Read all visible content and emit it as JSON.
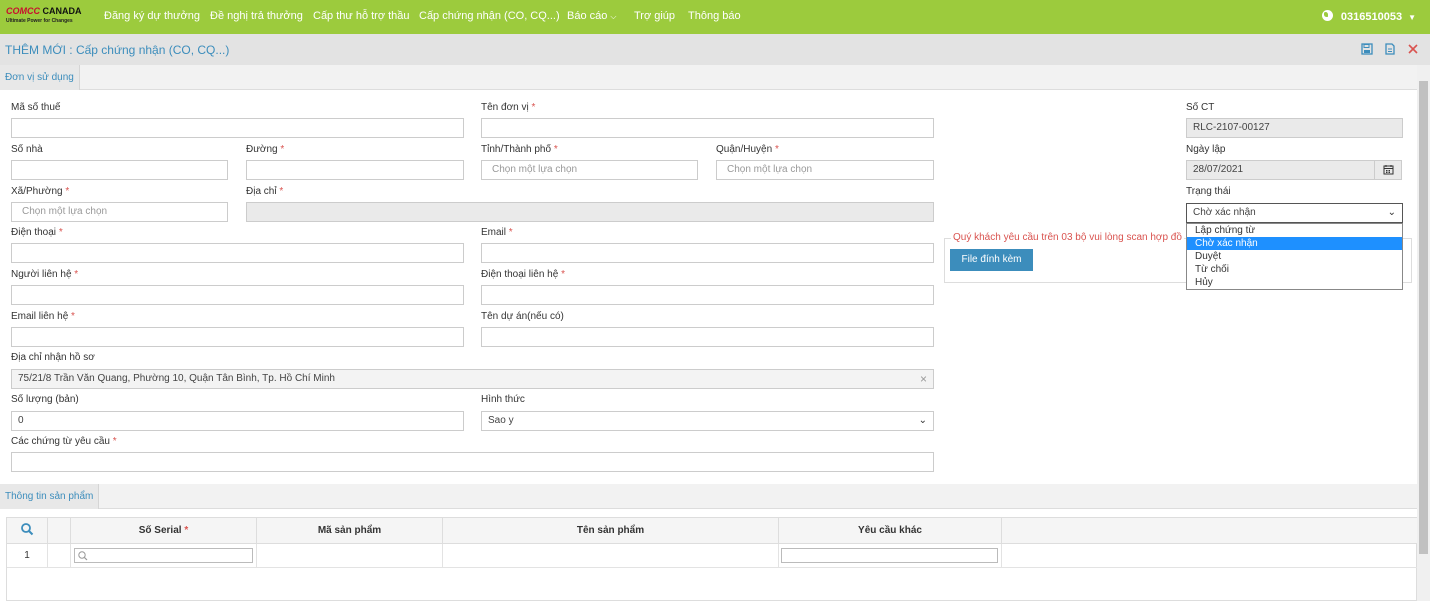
{
  "nav": {
    "logo_line1a": "COMCC",
    "logo_line1b": "CANADA",
    "logo_line2": "Ultimate Power for Changes",
    "items": [
      {
        "label": "Đăng ký dự thưởng"
      },
      {
        "label": "Đề nghị trả thưởng"
      },
      {
        "label": "Cấp thư hỗ trợ thầu"
      },
      {
        "label": "Cấp chứng nhận (CO, CQ...)"
      },
      {
        "label": "Báo cáo"
      },
      {
        "label": "Trợ giúp"
      },
      {
        "label": "Thông báo"
      }
    ],
    "account": "0316510053"
  },
  "colors": {
    "nav_bg": "#9ccb3d",
    "accent": "#3c8dbc",
    "required": "#d9534f",
    "selected": "#1e90ff"
  },
  "title": "THÊM MỚI : Cấp chứng nhận (CO, CQ...)",
  "toolbar_icons": [
    "save-icon",
    "document-icon",
    "close-icon"
  ],
  "section1": {
    "tab": "Đơn vị sử dụng"
  },
  "form": {
    "ma_so_thue": {
      "label": "Mã số thuế",
      "value": ""
    },
    "ten_don_vi": {
      "label": "Tên đơn vị",
      "value": ""
    },
    "so_ct": {
      "label": "Số CT",
      "value": "RLC-2107-00127"
    },
    "so_nha": {
      "label": "Số nhà",
      "value": ""
    },
    "duong": {
      "label": "Đường",
      "value": ""
    },
    "tinh": {
      "label": "Tỉnh/Thành phố",
      "placeholder": "Chọn một lựa chọn"
    },
    "quan": {
      "label": "Quận/Huyện",
      "placeholder": "Chọn một lựa chọn"
    },
    "ngay_lap": {
      "label": "Ngày lập",
      "value": "28/07/2021"
    },
    "xa": {
      "label": "Xã/Phường",
      "placeholder": "Chọn một lựa chọn"
    },
    "dia_chi": {
      "label": "Địa chỉ",
      "value": ""
    },
    "trang_thai": {
      "label": "Trạng thái",
      "value": "Chờ xác nhận",
      "options": [
        "Lập chứng từ",
        "Chờ xác nhận",
        "Duyệt",
        "Từ chối",
        "Hủy"
      ]
    },
    "dien_thoai": {
      "label": "Điện thoại",
      "value": ""
    },
    "email": {
      "label": "Email",
      "value": ""
    },
    "nguoi_lien_he": {
      "label": "Người liên hệ",
      "value": ""
    },
    "dt_lien_he": {
      "label": "Điện thoại liên hệ",
      "value": ""
    },
    "email_lien_he": {
      "label": "Email liên hệ",
      "value": ""
    },
    "ten_du_an": {
      "label": "Tên dự án(nếu có)",
      "value": ""
    },
    "dia_chi_nhan": {
      "label": "Địa chỉ nhận hồ sơ",
      "value": "75/21/8 Trần Văn Quang, Phường 10, Quận Tân Bình, Tp. Hồ Chí Minh"
    },
    "so_luong": {
      "label": "Số lượng (bản)",
      "value": "0"
    },
    "hinh_thuc": {
      "label": "Hình thức",
      "value": "Sao y"
    },
    "chung_tu": {
      "label": "Các chứng từ yêu cầu",
      "value": ""
    },
    "required_mark": "*"
  },
  "attach": {
    "note": "Quý khách yêu cầu trên 03 bộ vui lòng scan hợp đồ",
    "button": "File đính kèm"
  },
  "section2": {
    "tab": "Thông tin sản phẩm"
  },
  "grid": {
    "columns": [
      "Số Serial",
      "Mã sản phẩm",
      "Tên sản phẩm",
      "Yêu cầu khác"
    ],
    "rows": [
      {
        "index": "1"
      }
    ]
  }
}
